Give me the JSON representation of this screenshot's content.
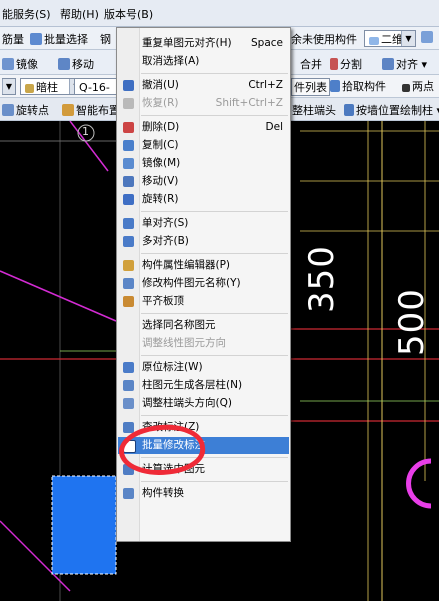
{
  "menubar": {
    "items": [
      "能服务(S)",
      "帮助(H)",
      "版本号(B)"
    ]
  },
  "toolbar1": {
    "items": [
      "筋量",
      "批量选择",
      "钢",
      "余未使用构件"
    ],
    "view_select": "二维"
  },
  "toolbar2": {
    "items": [
      "镜像",
      "移动",
      "合并",
      "分割",
      "对齐"
    ]
  },
  "toolbar3": {
    "type_select": "暗柱",
    "name_select": "Q-16-",
    "buttons": [
      "件列表",
      "拾取构件",
      "两点"
    ]
  },
  "toolbar4": {
    "items": [
      "旋转点",
      "智能布置",
      "整柱端头",
      "按墙位置绘制柱"
    ]
  },
  "canvas": {
    "axis_label": "1",
    "dim_350": "350",
    "dim_500": "500"
  },
  "context_menu": {
    "groups": [
      [
        {
          "label": "重复单图元对齐(H)",
          "shortcut": "Space",
          "icon": ""
        },
        {
          "label": "取消选择(A)",
          "shortcut": "",
          "icon": ""
        }
      ],
      [
        {
          "label": "撤消(U)",
          "shortcut": "Ctrl+Z",
          "icon": "undo-icon"
        },
        {
          "label": "恢复(R)",
          "shortcut": "Shift+Ctrl+Z",
          "icon": "redo-icon",
          "disabled": true
        }
      ],
      [
        {
          "label": "删除(D)",
          "shortcut": "Del",
          "icon": "delete-icon"
        },
        {
          "label": "复制(C)",
          "icon": "copy-icon"
        },
        {
          "label": "镜像(M)",
          "icon": "mirror-icon"
        },
        {
          "label": "移动(V)",
          "icon": "move-icon"
        },
        {
          "label": "旋转(R)",
          "icon": "rotate-icon"
        }
      ],
      [
        {
          "label": "单对齐(S)",
          "icon": "align-single-icon"
        },
        {
          "label": "多对齐(B)",
          "icon": "align-multi-icon"
        }
      ],
      [
        {
          "label": "构件属性编辑器(P)",
          "icon": "property-editor-icon"
        },
        {
          "label": "修改构件图元名称(Y)",
          "icon": "rename-icon"
        },
        {
          "label": "平齐板顶",
          "icon": "flush-slab-icon"
        }
      ],
      [
        {
          "label": "选择同名称图元",
          "icon": ""
        },
        {
          "label": "调整线性图元方向",
          "icon": "",
          "disabled": true
        }
      ],
      [
        {
          "label": "原位标注(W)",
          "icon": "annotate-icon"
        },
        {
          "label": "柱图元生成各层柱(N)",
          "icon": "column-layers-icon"
        },
        {
          "label": "调整柱端头方向(Q)",
          "icon": "column-head-icon"
        }
      ],
      [
        {
          "label": "查改标注(Z)",
          "icon": "check-annotation-icon"
        },
        {
          "label": "批量修改标注",
          "icon": "batch-annotation-icon",
          "highlighted": true
        }
      ],
      [
        {
          "label": "计算选中图元",
          "icon": "calculate-icon"
        }
      ],
      [
        {
          "label": "构件转换",
          "icon": "convert-icon"
        }
      ]
    ]
  }
}
